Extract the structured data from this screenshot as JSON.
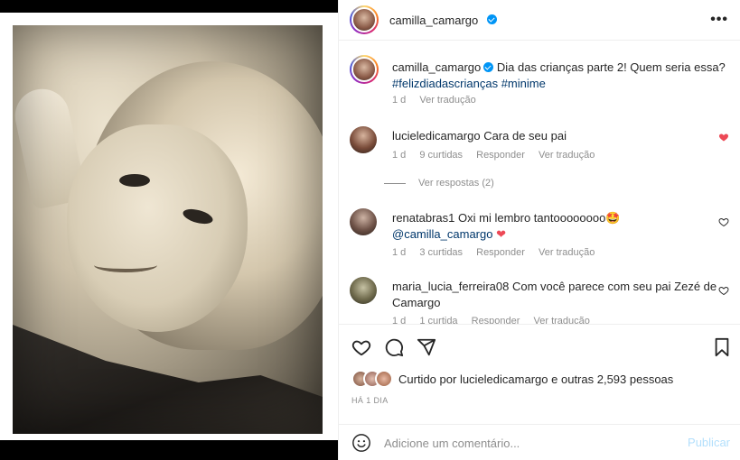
{
  "post": {
    "author": "camilla_camargo",
    "more_icon": "more-horizontal-icon"
  },
  "caption": {
    "username": "camilla_camargo",
    "text": "Dia das crianças parte 2! Quem seria essa?",
    "hashtags": [
      "#felizdiadascrianças",
      "#minime"
    ],
    "time": "1 d",
    "translate": "Ver tradução"
  },
  "comments": [
    {
      "username": "lucieledicamargo",
      "text": "Cara de seu pai",
      "time": "1 d",
      "likes": "9 curtidas",
      "reply": "Responder",
      "translate": "Ver tradução",
      "liked": true,
      "view_replies": "Ver respostas (2)"
    },
    {
      "username": "renatabras1",
      "text": "Oxi mi lembro tantoooooooo",
      "emoji": "🤩",
      "mention": "@camilla_camargo",
      "heart": "❤",
      "time": "1 d",
      "likes": "3 curtidas",
      "reply": "Responder",
      "translate": "Ver tradução",
      "liked": false
    },
    {
      "username": "maria_lucia_ferreira08",
      "text": "Com você parece com seu pai Zezé de Camargo",
      "time": "1 d",
      "likes": "1 curtida",
      "reply": "Responder",
      "translate": "Ver tradução",
      "liked": false
    }
  ],
  "actions": {
    "like_icon": "heart-icon",
    "comment_icon": "comment-icon",
    "share_icon": "send-icon",
    "save_icon": "bookmark-icon"
  },
  "likes": {
    "prefix": "Curtido por",
    "user": "lucieledicamargo",
    "conj": "e",
    "others": "outras 2,593 pessoas"
  },
  "timestamp": "HÁ 1 DIA",
  "add_comment": {
    "placeholder": "Adicione um comentário...",
    "post_label": "Publicar"
  },
  "colors": {
    "link": "#00376b",
    "verified": "#0095f6",
    "heart": "#ed4956",
    "muted": "#8e8e8e"
  }
}
